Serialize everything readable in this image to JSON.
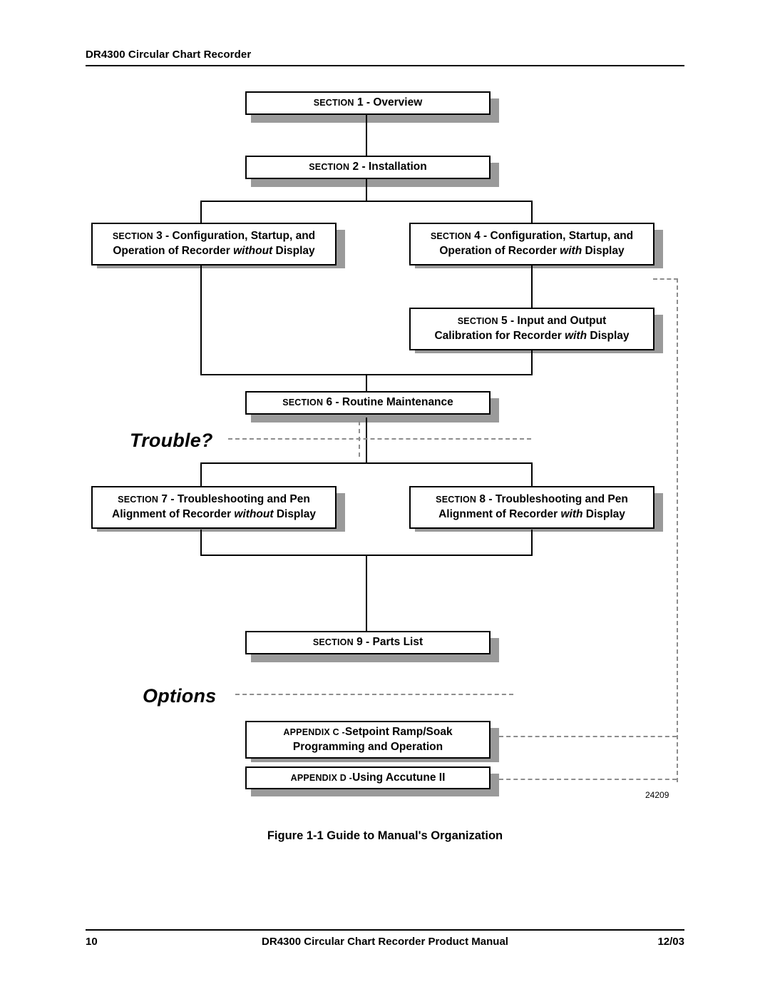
{
  "header": {
    "title": "DR4300 Circular Chart Recorder"
  },
  "footer": {
    "page_number": "10",
    "center_text": "DR4300 Circular Chart Recorder Product Manual",
    "date": "12/03"
  },
  "figure": {
    "number": "Figure 1-1",
    "caption": "Guide to Manual's Organization",
    "full_caption": "Figure 1-1  Guide to Manual's Organization",
    "drawing_number": "24209"
  },
  "diagram": {
    "side_labels": {
      "trouble": "Trouble?",
      "options": "Options"
    },
    "nodes": [
      {
        "id": "section1",
        "prefix": "SECTION",
        "number": "1",
        "separator": "-",
        "title": "Overview",
        "line1": "SECTION 1 - Overview",
        "line2": ""
      },
      {
        "id": "section2",
        "prefix": "SECTION",
        "number": "2",
        "separator": "-",
        "title": "Installation",
        "line1": "SECTION 2 - Installation",
        "line2": ""
      },
      {
        "id": "section3",
        "prefix": "SECTION",
        "number": "3",
        "separator": "-",
        "title": "Configuration, Startup, and Operation of Recorder without Display",
        "line1": "SECTION 3 - Configuration, Startup, and",
        "line2_pre": "Operation of Recorder",
        "line2_em": "without",
        "line2_post": "Display"
      },
      {
        "id": "section4",
        "prefix": "SECTION",
        "number": "4",
        "separator": "-",
        "title": "Configuration, Startup, and Operation of Recorder with Display",
        "line1": "SECTION 4 - Configuration, Startup, and",
        "line2_pre": "Operation of Recorder",
        "line2_em": "with",
        "line2_post": "Display"
      },
      {
        "id": "section5",
        "prefix": "SECTION",
        "number": "5",
        "separator": "-",
        "title": "Input and Output Calibration for Recorder with Display",
        "line1": "SECTION 5 - Input and Output",
        "line2_pre": "Calibration for Recorder",
        "line2_em": "with",
        "line2_post": "Display"
      },
      {
        "id": "section6",
        "prefix": "SECTION",
        "number": "6",
        "separator": "-",
        "title": "Routine Maintenance",
        "line1": "SECTION 6 - Routine Maintenance",
        "line2": ""
      },
      {
        "id": "section7",
        "prefix": "SECTION",
        "number": "7",
        "separator": "-",
        "title": "Troubleshooting and Pen Alignment of Recorder without Display",
        "line1": "SECTION 7 - Troubleshooting and Pen",
        "line2_pre": "Alignment of Recorder",
        "line2_em": "without",
        "line2_post": "Display"
      },
      {
        "id": "section8",
        "prefix": "SECTION",
        "number": "8",
        "separator": "-",
        "title": "Troubleshooting and Pen Alignment of Recorder with Display",
        "line1": "SECTION 8 - Troubleshooting and Pen",
        "line2_pre": "Alignment of Recorder",
        "line2_em": "with",
        "line2_post": "Display"
      },
      {
        "id": "section9",
        "prefix": "SECTION",
        "number": "9",
        "separator": "-",
        "title": "Parts List",
        "line1": "SECTION 9 - Parts List",
        "line2": ""
      },
      {
        "id": "appendixc",
        "prefix": "APPENDIX",
        "number": "C",
        "separator": "-",
        "title": "Setpoint Ramp/Soak Programming and Operation",
        "line1": "Setpoint Ramp/Soak",
        "line2": "Programming and Operation"
      },
      {
        "id": "appendixd",
        "prefix": "APPENDIX",
        "number": "D",
        "separator": "-",
        "title": "Using Accutune II",
        "line1": "Using Accutune II",
        "line2": ""
      }
    ]
  },
  "colors": {
    "box_border": "#000000",
    "box_fill": "#ffffff",
    "shadow": "#9a9a9a",
    "dashed_line": "#8d8d8d",
    "text": "#000000"
  }
}
